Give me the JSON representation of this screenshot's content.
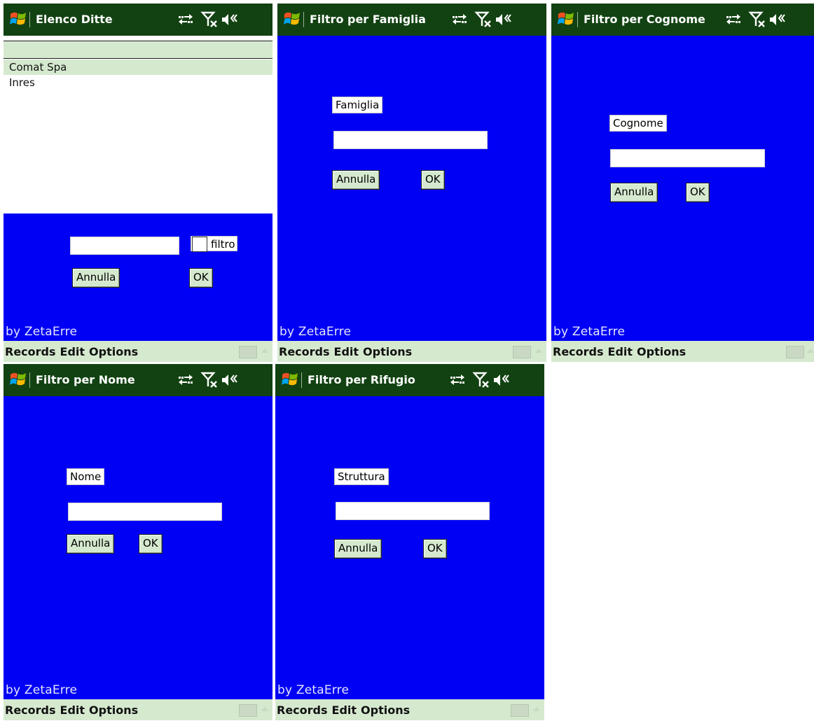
{
  "screens": {
    "elenco": {
      "title": "Elenco Ditte",
      "items": [
        "Comat Spa",
        "Inres"
      ],
      "checkbox_label": "filtro",
      "cancel": "Annulla",
      "ok": "OK",
      "byline": "by ZetaErre",
      "menu": [
        "Records",
        "Edit",
        "Options"
      ]
    },
    "famiglia": {
      "title": "Filtro per Famiglia",
      "field_label": "Famiglia",
      "cancel": "Annulla",
      "ok": "OK",
      "byline": "by ZetaErre",
      "menu": [
        "Records",
        "Edit",
        "Options"
      ]
    },
    "cognome": {
      "title": "Filtro per Cognome",
      "field_label": "Cognome",
      "cancel": "Annulla",
      "ok": "OK",
      "byline": "by ZetaErre",
      "menu": [
        "Records",
        "Edit",
        "Options"
      ]
    },
    "nome": {
      "title": "Filtro per Nome",
      "field_label": "Nome",
      "cancel": "Annulla",
      "ok": "OK",
      "byline": "by ZetaErre",
      "menu": [
        "Records",
        "Edit",
        "Options"
      ]
    },
    "rifugio": {
      "title": "Filtro per Rifugio",
      "field_label": "Struttura",
      "cancel": "Annulla",
      "ok": "OK",
      "byline": "by ZetaErre",
      "menu": [
        "Records",
        "Edit",
        "Options"
      ]
    }
  },
  "colors": {
    "titlebar": "#124212",
    "form_background": "#0000f5",
    "menubar": "#d5e9cf",
    "selected_row": "#d5e9cf"
  },
  "icons": [
    "windows-start-icon",
    "connectivity-icon",
    "no-signal-icon",
    "volume-icon",
    "keyboard-icon"
  ]
}
